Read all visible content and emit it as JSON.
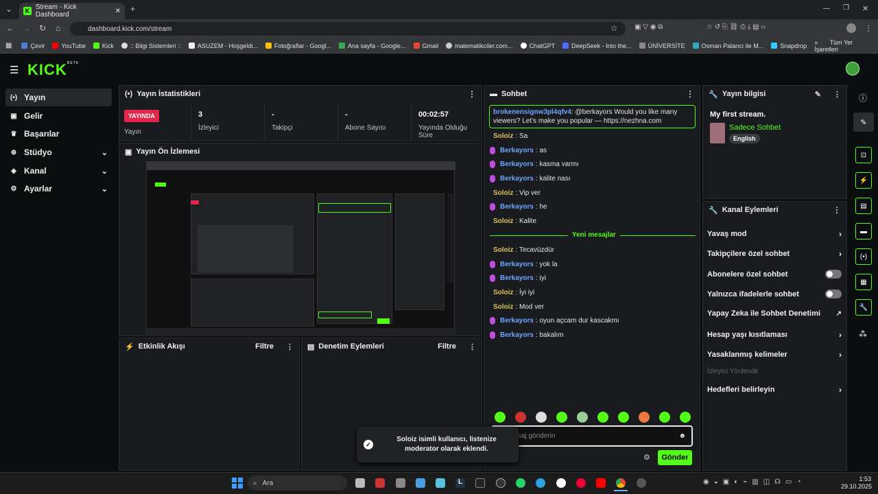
{
  "browser": {
    "tab_title": "Stream - Kick Dashboard",
    "url": "dashboard.kick.com/stream",
    "bookmarks": [
      "Çevir",
      "YouTube",
      "Kick",
      ":: Bilgi Sistemleri ::",
      "ASUZEM - Hoşgeldi...",
      "Fotoğraflar - Googl...",
      "Ana sayfa - Google...",
      "Gmail",
      "matematikciler.com...",
      "ChatGPT",
      "DeepSeek - Into the...",
      "ÜNİVERSİTE",
      "Osman Palancı ile M...",
      "Snapdrop"
    ],
    "all_bookmarks": "Tüm Yer İşaretleri"
  },
  "header": {
    "logo": "KICK",
    "beta": "BETA"
  },
  "sidebar": {
    "items": [
      {
        "label": "Yayın",
        "icon": "broadcast-icon"
      },
      {
        "label": "Gelir",
        "icon": "wallet-icon"
      },
      {
        "label": "Başarılar",
        "icon": "trophy-icon"
      },
      {
        "label": "Stüdyo",
        "icon": "studio-icon"
      },
      {
        "label": "Kanal",
        "icon": "channel-icon"
      },
      {
        "label": "Ayarlar",
        "icon": "gear-icon"
      }
    ]
  },
  "stats": {
    "title": "Yayın İstatistikleri",
    "live_badge": "YAYINDA",
    "items": [
      {
        "label": "Yayın",
        "value": ""
      },
      {
        "label": "İzleyici",
        "value": "3"
      },
      {
        "label": "Takipçi",
        "value": "-"
      },
      {
        "label": "Abone Sayısı",
        "value": "-"
      },
      {
        "label": "Yayında Olduğu Süre",
        "value": "00:02:57"
      }
    ]
  },
  "preview": {
    "title": "Yayın Ön İzlemesi"
  },
  "activity": {
    "title": "Etkinlik Akışı",
    "filter": "Filtre"
  },
  "moderation": {
    "title": "Denetim Eylemleri",
    "filter": "Filtre"
  },
  "chat": {
    "title": "Sohbet",
    "pinned": {
      "user": "brokenensignw3pl4qfv4",
      "text": ": @berkayors Would you like many viewers? Let's make you popular — https://nezhna.com"
    },
    "messages": [
      {
        "user": "Soloiz",
        "text": ": Sa",
        "mic": false
      },
      {
        "user": "Berkayors",
        "text": ": as",
        "mic": true
      },
      {
        "user": "Berkayors",
        "text": ": kasma varmı",
        "mic": true
      },
      {
        "user": "Berkayors",
        "text": ": kalite nası",
        "mic": true
      },
      {
        "user": "Soloiz",
        "text": ": Vip ver",
        "mic": false
      },
      {
        "user": "Berkayors",
        "text": ": he",
        "mic": true
      },
      {
        "user": "Soloiz",
        "text": ": Kalite",
        "mic": false
      }
    ],
    "new_messages": "Yeni mesajlar",
    "messages2": [
      {
        "user": "Soloiz",
        "text": ": Tecavüzdür",
        "mic": false
      },
      {
        "user": "Berkayors",
        "text": ": yok la",
        "mic": true
      },
      {
        "user": "Berkayors",
        "text": ": iyi",
        "mic": true
      },
      {
        "user": "Soloiz",
        "text": ": İyi iyi",
        "mic": false
      },
      {
        "user": "Soloiz",
        "text": ": Mod ver",
        "mic": false
      },
      {
        "user": "Berkayors",
        "text": ": oyun açcam dur kascakmı",
        "mic": true
      },
      {
        "user": "Berkayors",
        "text": ": bakalım",
        "mic": true
      }
    ],
    "input_placeholder": "Bir mesaj gönderin",
    "send": "Gönder"
  },
  "toast": {
    "text": "Soloiz isimli kullanıcı, listenize moderator olarak eklendi."
  },
  "stream_info": {
    "title": "Yayın bilgisi",
    "stream_title": "My first stream.",
    "category": "Sadece Sohbet",
    "language": "English"
  },
  "channel_actions": {
    "title": "Kanal Eylemleri",
    "items": [
      {
        "label": "Yavaş mod",
        "control": "arrow"
      },
      {
        "label": "Takipçilere özel sohbet",
        "control": "arrow"
      },
      {
        "label": "Abonelere özel sohbet",
        "control": "toggle"
      },
      {
        "label": "Yalnızca ifadelerle sohbet",
        "control": "toggle"
      },
      {
        "label": "Yapay Zeka ile Sohbet Denetimi",
        "control": "external"
      },
      {
        "label": "Hesap yaşı kısıtlaması",
        "control": "arrow"
      },
      {
        "label": "Yasaklanmış kelimeler",
        "control": "arrow"
      },
      {
        "label": "İzleyici Yönlendir",
        "control": "disabled"
      },
      {
        "label": "Hedefleri belirleyin",
        "control": "arrow"
      }
    ]
  },
  "taskbar": {
    "search": "Ara",
    "time": "1:53",
    "date": "29.10.2025"
  },
  "colors": {
    "accent": "#53fc18",
    "live": "#e4254c",
    "soloiz": "#d9c25c",
    "berkayors": "#6ea7ff"
  }
}
